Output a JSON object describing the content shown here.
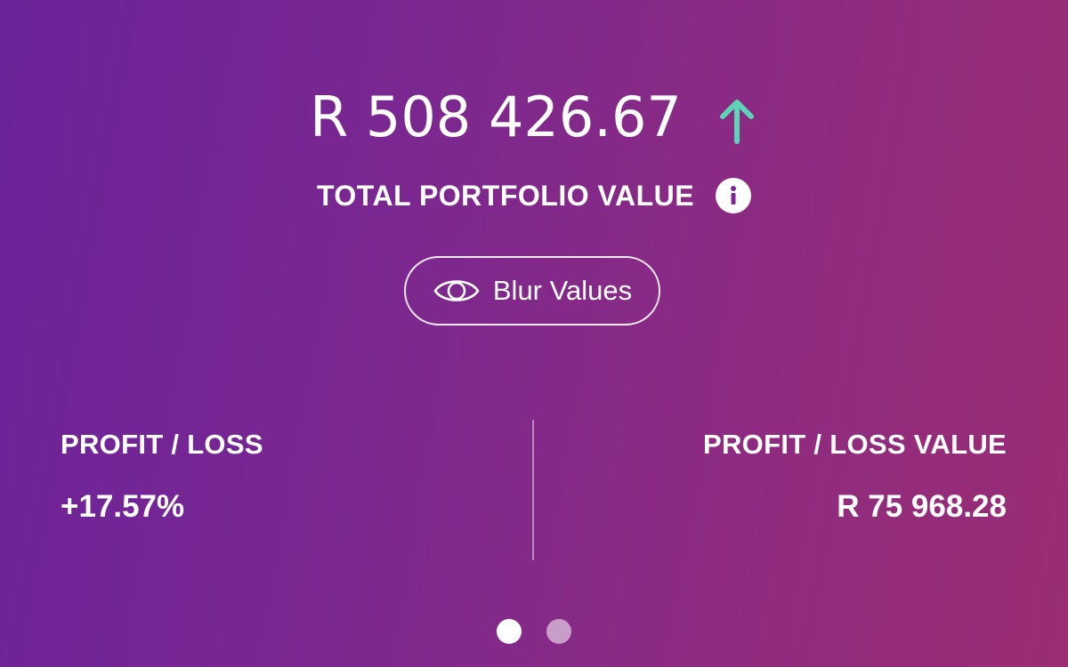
{
  "portfolio": {
    "total_value": "R 508 426.67",
    "trend_direction": "up",
    "trend_icon": "arrow-up-icon",
    "trend_color": "#5fd3b5",
    "label": "TOTAL PORTFOLIO VALUE",
    "info_icon": "info-icon"
  },
  "blur_button": {
    "icon": "eye-icon",
    "label": "Blur Values"
  },
  "stats": {
    "profit_loss": {
      "label": "PROFIT / LOSS",
      "value": "+17.57%"
    },
    "profit_loss_value": {
      "label": "PROFIT / LOSS VALUE",
      "value": "R 75 968.28"
    }
  },
  "pager": {
    "page_count": 2,
    "active_page": 1
  },
  "colors": {
    "gradient_start": "#6a2399",
    "gradient_end": "#9a2d74",
    "text": "#ffffff",
    "accent": "#5fd3b5"
  }
}
